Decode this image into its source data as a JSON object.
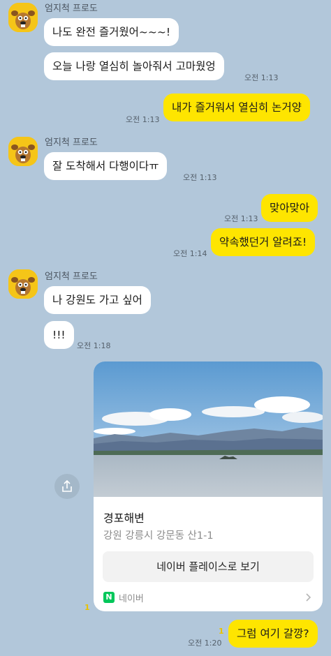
{
  "colors": {
    "background": "#b2c7da",
    "incoming_bubble": "#ffffff",
    "outgoing_bubble": "#fee500",
    "unread_count": "#e8c200",
    "naver_green": "#03c75a"
  },
  "sender_name": "엄지척 프로도",
  "messages": {
    "m1": "나도 완전 즐거웠어~~~!",
    "m2": "오늘 나랑 열심히 놀아줘서 고마웠엉",
    "m2_time": "오전 1:13",
    "m3": "내가 즐거워서 열심히 논거양",
    "m3_time": "오전 1:13",
    "m4": "잘 도착해서 다행이다ㅠ",
    "m4_time": "오전 1:13",
    "m5": "맞아맞아",
    "m5_time": "오전 1:13",
    "m6": "약속했던거 알려죠!",
    "m6_time": "오전 1:14",
    "m7": "나 강원도 가고 싶어",
    "m8": "!!!",
    "m8_time": "오전 1:18",
    "m9": "그럼 여기 갈깡?",
    "m9_unread": "1",
    "m9_time": "오전 1:20"
  },
  "place_card": {
    "title": "경포해변",
    "address": "강원 강릉시 강문동  산1-1",
    "button_label": "네이버 플레이스로 보기",
    "provider": "네이버",
    "provider_logo": "N",
    "unread": "1",
    "share_icon": "share-icon",
    "chevron_icon": "chevron-right-icon"
  }
}
